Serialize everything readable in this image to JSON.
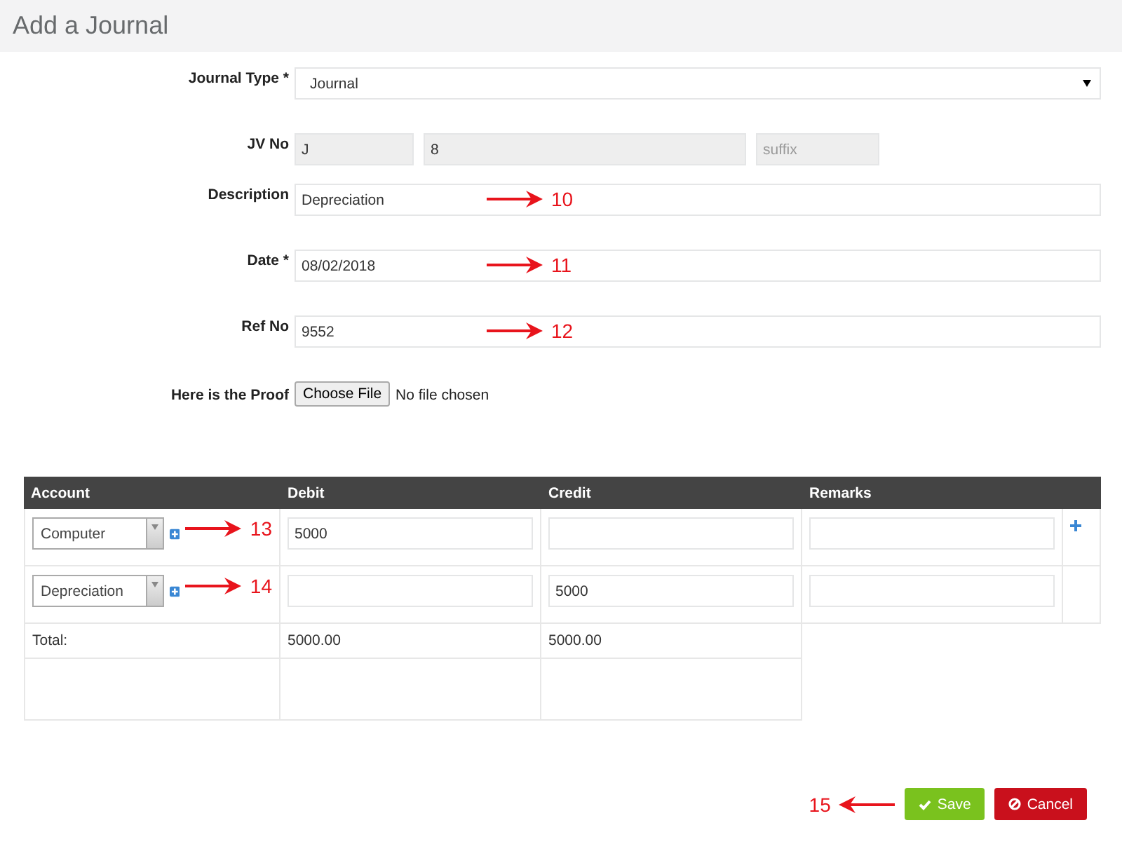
{
  "page": {
    "title": "Add a Journal"
  },
  "fields": [
    {
      "kind": "select",
      "label": "Journal Type *",
      "value": "Journal"
    },
    {
      "kind": "parts",
      "label": "JV No",
      "parts": [
        {
          "value": "J"
        },
        {
          "value": "8"
        },
        {
          "placeholder": "suffix"
        }
      ]
    },
    {
      "kind": "text",
      "label": "Description",
      "value": "Depreciation",
      "annotation": "10"
    },
    {
      "kind": "text",
      "label": "Date *",
      "value": "08/02/2018",
      "annotation": "11"
    },
    {
      "kind": "text",
      "label": "Ref No",
      "value": "9552",
      "annotation": "12"
    },
    {
      "kind": "file",
      "label": "Here is the Proof",
      "button": "Choose File",
      "status": "No file chosen"
    }
  ],
  "table": {
    "columns": [
      "Account",
      "Debit",
      "Credit",
      "Remarks"
    ],
    "rows": [
      {
        "account": "Computer",
        "debit": "5000",
        "annotation": "13",
        "add_row": true
      },
      {
        "account": "Depreciation",
        "credit": "5000",
        "annotation": "14",
        "add_row": false
      }
    ],
    "totals": {
      "label": "Total:",
      "debit": "5000.00",
      "credit": "5000.00"
    }
  },
  "footer": {
    "annotation": "15",
    "buttons": [
      {
        "kind": "save",
        "label": "Save"
      },
      {
        "kind": "cancel",
        "label": "Cancel"
      }
    ]
  }
}
